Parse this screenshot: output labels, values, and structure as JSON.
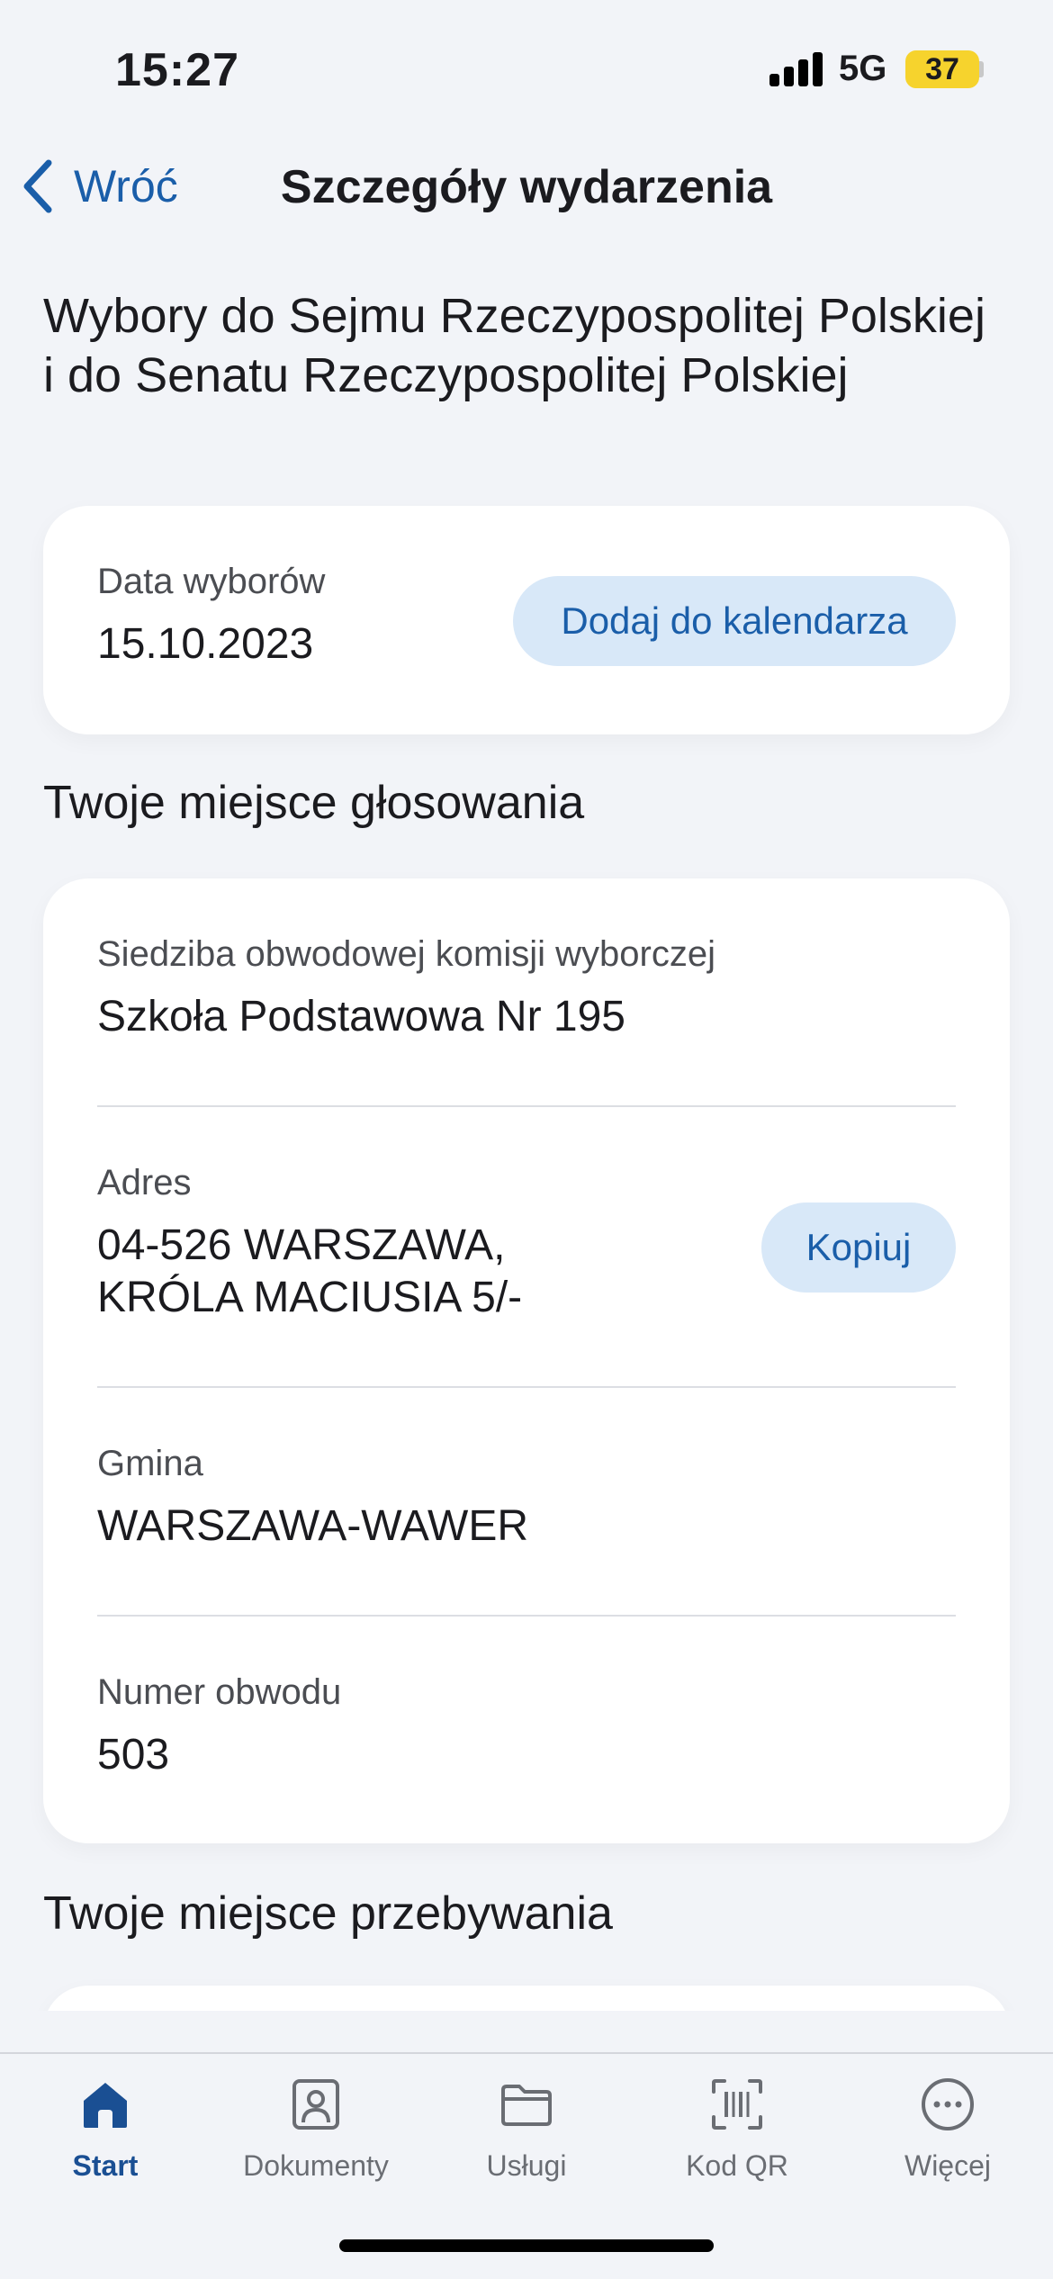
{
  "status_bar": {
    "time": "15:27",
    "network": "5G",
    "battery": "37"
  },
  "nav": {
    "back_label": "Wróć",
    "title": "Szczegóły wydarzenia"
  },
  "event": {
    "title": "Wybory do Sejmu Rzeczypospolitej Polskiej i do Senatu Rzeczypospolitej Polskiej"
  },
  "election_date": {
    "label": "Data wyborów",
    "value": "15.10.2023",
    "add_to_calendar_label": "Dodaj do kalendarza"
  },
  "voting_place": {
    "section_title": "Twoje miejsce głosowania",
    "seat_label": "Siedziba obwodowej komisji wyborczej",
    "seat_value": "Szkoła Podstawowa Nr 195",
    "address_label": "Adres",
    "address_line1": "04-526 WARSZAWA,",
    "address_line2": "KRÓLA MACIUSIA 5/-",
    "copy_label": "Kopiuj",
    "municipality_label": "Gmina",
    "municipality_value": "WARSZAWA-WAWER",
    "district_label": "Numer obwodu",
    "district_value": "503"
  },
  "stay_place": {
    "section_title": "Twoje miejsce przebywania"
  },
  "tabs": [
    {
      "label": "Start",
      "icon": "home-icon",
      "active": true
    },
    {
      "label": "Dokumenty",
      "icon": "id-card-icon",
      "active": false
    },
    {
      "label": "Usługi",
      "icon": "folder-icon",
      "active": false
    },
    {
      "label": "Kod QR",
      "icon": "qr-scan-icon",
      "active": false
    },
    {
      "label": "Więcej",
      "icon": "more-icon",
      "active": false
    }
  ],
  "colors": {
    "accent": "#1a5ea9",
    "pill_bg": "#d8e8f8",
    "battery": "#f6d32d",
    "background": "#f2f4f8"
  }
}
